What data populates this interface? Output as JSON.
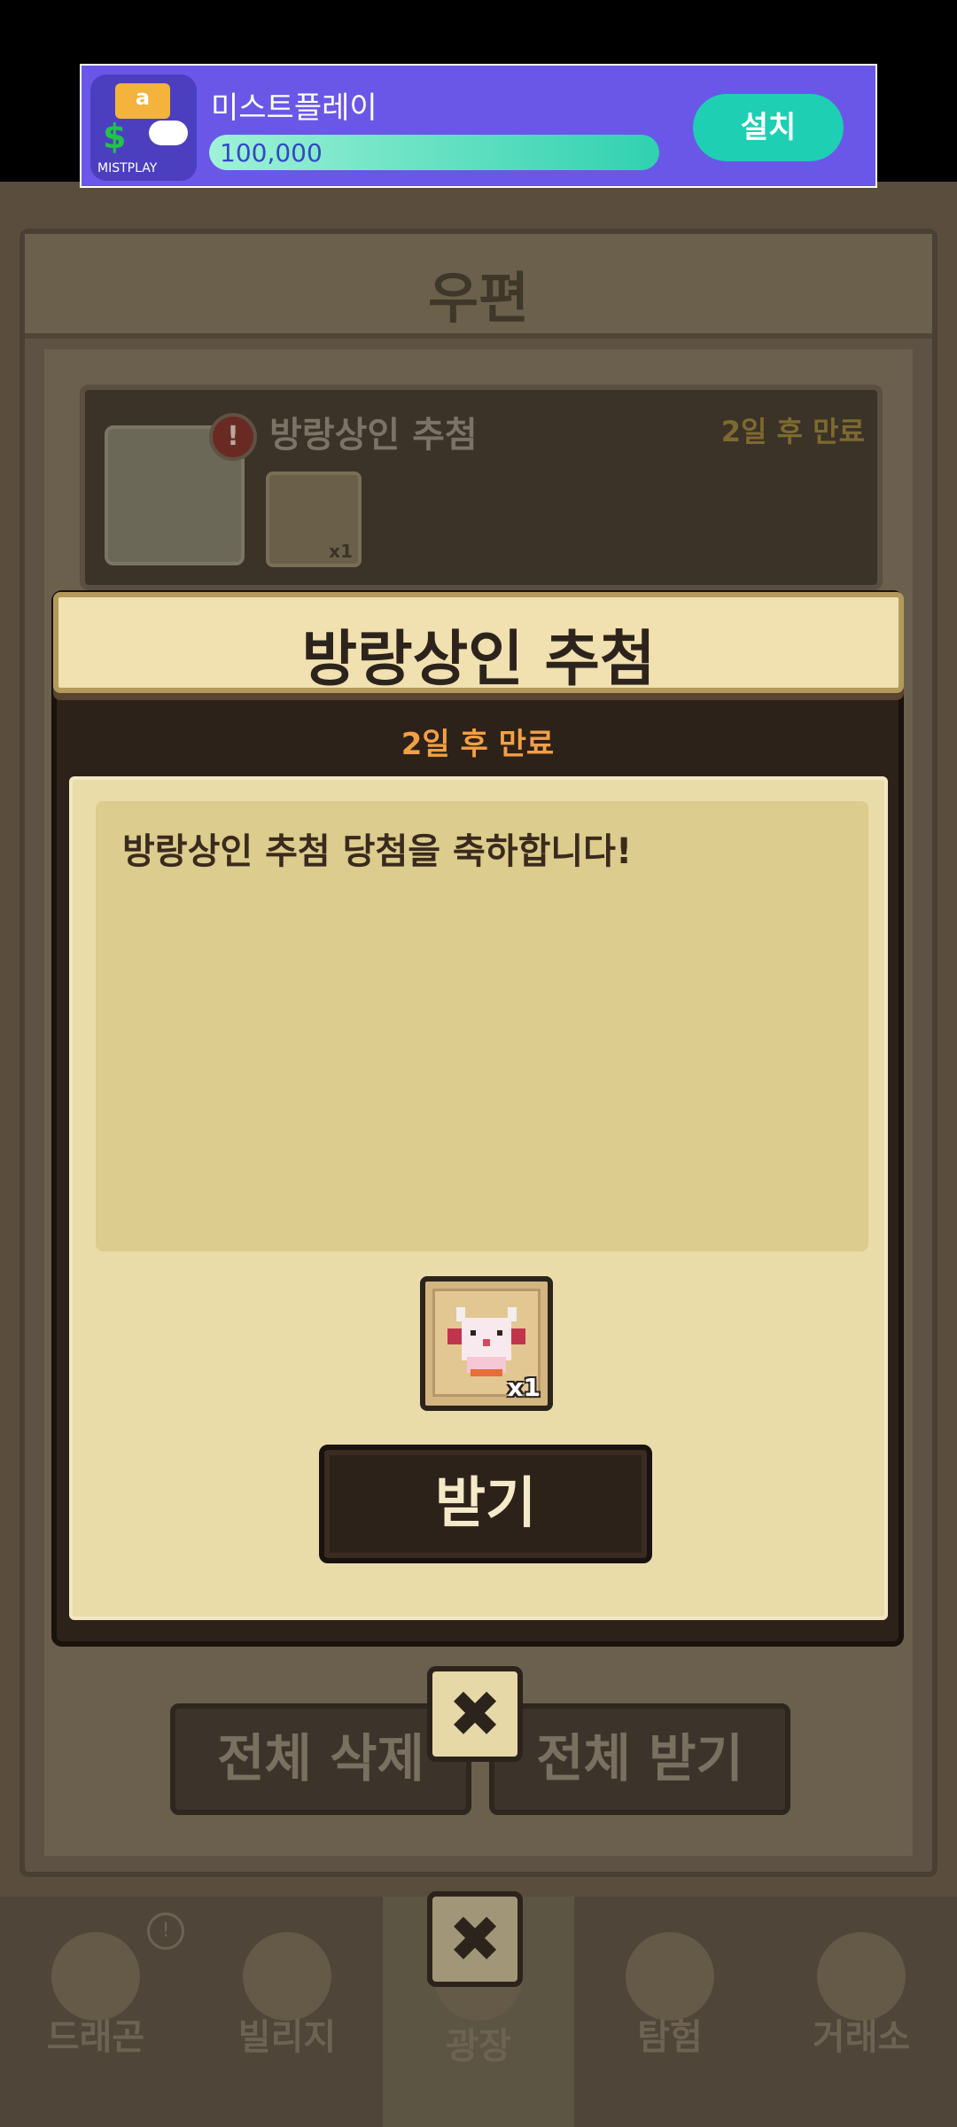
{
  "ad": {
    "app_name": "미스트플레이",
    "counter": "100,000",
    "install_label": "설치",
    "icon_brand": "MISTPLAY",
    "icon_box_glyph": "a",
    "icon_dollar_glyph": "$"
  },
  "mail_window": {
    "title": "우편",
    "item": {
      "title": "방랑상인 추첨",
      "expiry": "2일 후 만료",
      "alert_glyph": "!",
      "count": "x1"
    },
    "delete_all_label": "전체 삭제",
    "claim_all_label": "전체 받기",
    "close_glyph": "✖"
  },
  "popup": {
    "title": "방랑상인 추첨",
    "expiry": "2일 후 만료",
    "message": "방랑상인 추첨 당첨을 축하합니다!",
    "reward_count": "x1",
    "claim_label": "받기"
  },
  "bottom_nav": {
    "items": [
      {
        "label": "드래곤",
        "badge": "!"
      },
      {
        "label": "빌리지"
      },
      {
        "label": "광장"
      },
      {
        "label": "탐험"
      },
      {
        "label": "거래소"
      }
    ],
    "close_glyph": "✖"
  },
  "colors": {
    "ad_background": "#6a57e8",
    "install_button": "#1ecfb4",
    "popup_header": "#f1e0b0",
    "expiry_text": "#f3a044",
    "paper": "#e9dca9"
  },
  "icons": {
    "ad_app": "mistplay-app-icon",
    "envelope": "envelope-icon",
    "reward": "pixel-dragon-icon",
    "close": "close-icon"
  }
}
